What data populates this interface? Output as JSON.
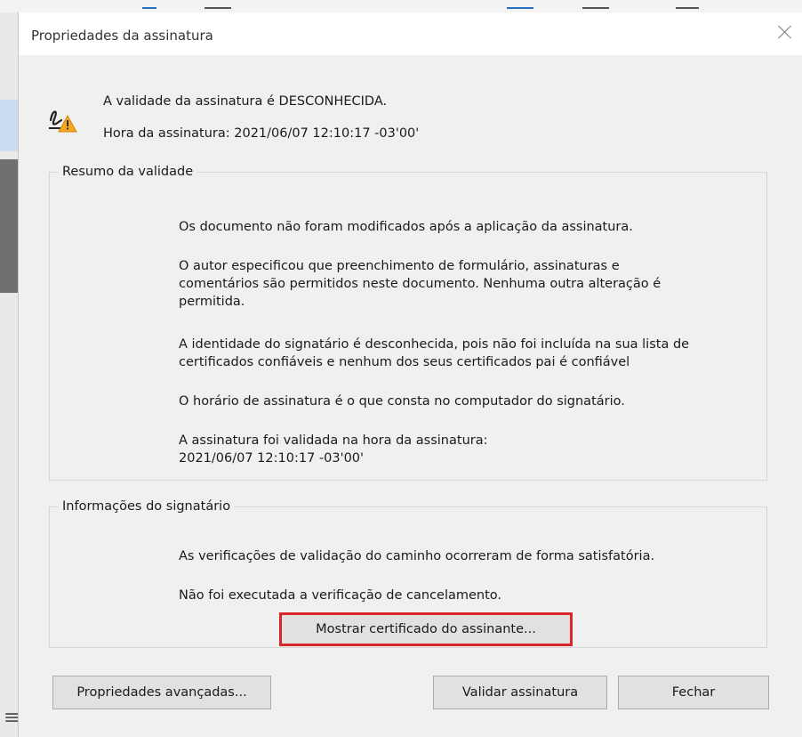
{
  "window": {
    "title": "Propriedades da assinatura"
  },
  "header": {
    "icon": "signature-warning-icon",
    "status_line": "A validade da assinatura é DESCONHECIDA.",
    "time_line": "Hora da assinatura: 2021/06/07 12:10:17 -03'00'"
  },
  "validity_summary": {
    "legend": "Resumo da validade",
    "items": [
      "Os documento não foram modificados após a aplicação da assinatura.",
      "O autor especificou que preenchimento de formulário, assinaturas e\ncomentários são permitidos neste documento. Nenhuma outra alteração é\npermitida.",
      "A identidade do signatário é desconhecida, pois não foi incluída na sua lista de\ncertificados confiáveis e nenhum dos seus certificados pai é confiável",
      "O horário de assinatura é o que consta no computador do signatário.",
      "A assinatura foi validada na hora da assinatura:\n2021/06/07 12:10:17 -03'00'"
    ]
  },
  "signer_info": {
    "legend": "Informações do signatário",
    "items": [
      "As verificações de validação do caminho ocorreram de forma satisfatória.",
      "Não foi executada a verificação de cancelamento."
    ],
    "show_certificate_label": "Mostrar certificado do assinante..."
  },
  "footer": {
    "advanced_label": "Propriedades avançadas...",
    "validate_label": "Validar assinatura",
    "close_label": "Fechar"
  },
  "colors": {
    "highlight": "#d9262c",
    "warning": "#f5a623",
    "dialog_bg": "#f0f0f0"
  }
}
